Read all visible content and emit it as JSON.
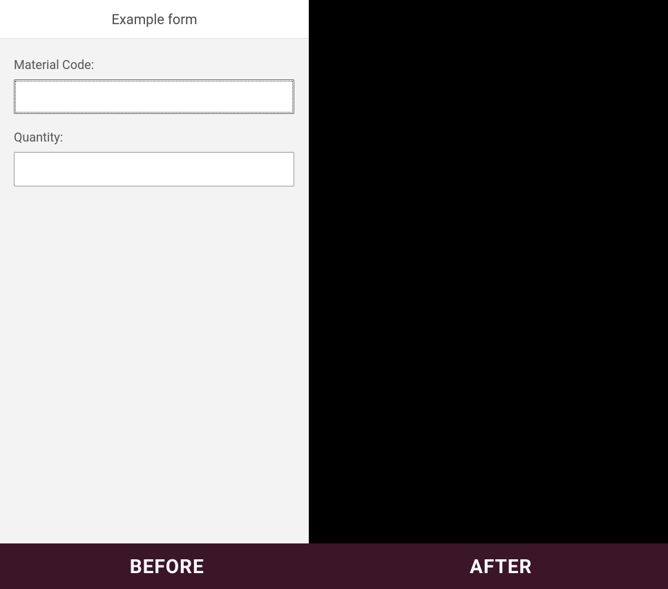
{
  "header": {
    "title": "Example form"
  },
  "fields": {
    "material_code": {
      "label": "Material Code:",
      "value": ""
    },
    "quantity": {
      "label": "Quantity:",
      "value": ""
    }
  },
  "footer": {
    "before_label": "BEFORE",
    "after_label": "AFTER"
  }
}
